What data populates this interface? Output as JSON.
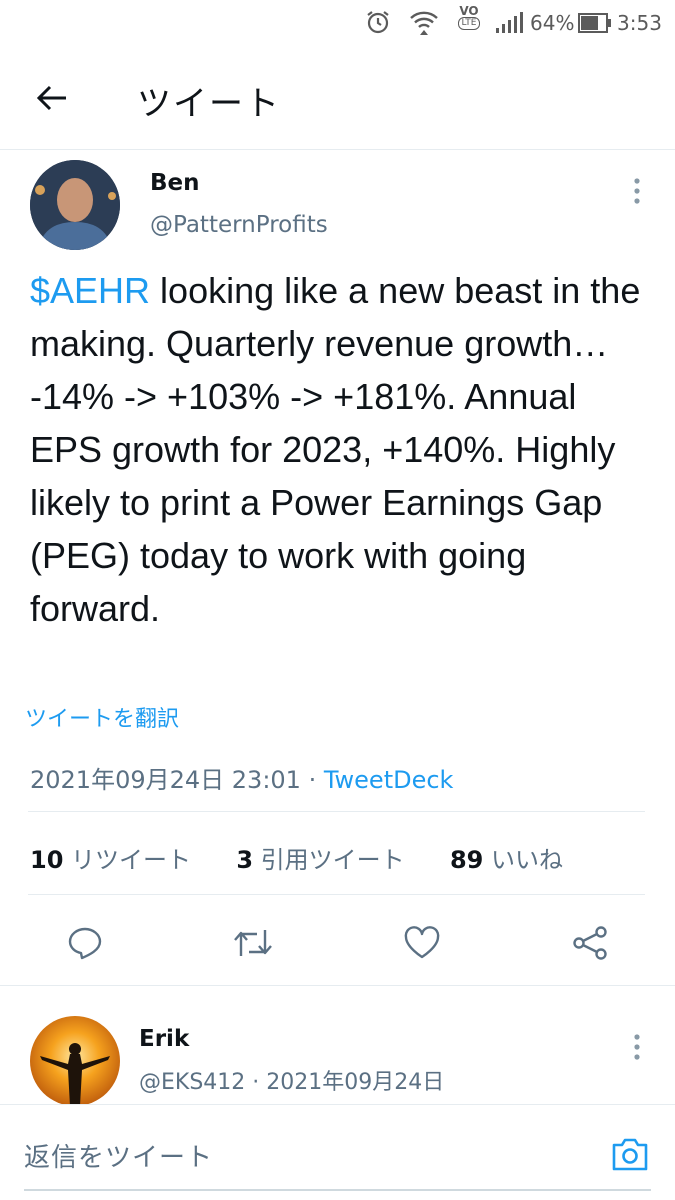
{
  "status_bar": {
    "battery": "64%",
    "time": "3:53",
    "volte_top": "VO",
    "volte_bottom": "LTE"
  },
  "header": {
    "title": "ツイート"
  },
  "tweet": {
    "author_name": "Ben",
    "author_handle": "@PatternProfits",
    "cashtag": "$AEHR",
    "body": " looking like a new beast in the making. Quarterly revenue growth… -14% -> +103% -> +181%. Annual EPS growth for 2023, +140%. Highly likely to print a Power Earnings Gap (PEG) today to work with going forward.",
    "translate_link": "ツイートを翻訳",
    "timestamp": "2021年09月24日 23:01",
    "separator": " · ",
    "client": "TweetDeck",
    "stats": {
      "retweets_count": "10",
      "retweets_label": "リツイート",
      "quotes_count": "3",
      "quotes_label": "引用ツイート",
      "likes_count": "89",
      "likes_label": "いいね"
    }
  },
  "reply": {
    "author_name": "Erik",
    "author_handle": "@EKS412",
    "separator": " · ",
    "date": "2021年09月24日"
  },
  "composer": {
    "placeholder": "返信をツイート"
  },
  "colors": {
    "link_blue": "#1d9bf0",
    "muted_gray": "#5b7083",
    "divider": "#e6ecf0"
  },
  "icons": {
    "reply": "speech-bubble-icon",
    "retweet": "retweet-arrows-icon",
    "like": "heart-icon",
    "share": "share-nodes-icon",
    "camera": "camera-icon"
  }
}
